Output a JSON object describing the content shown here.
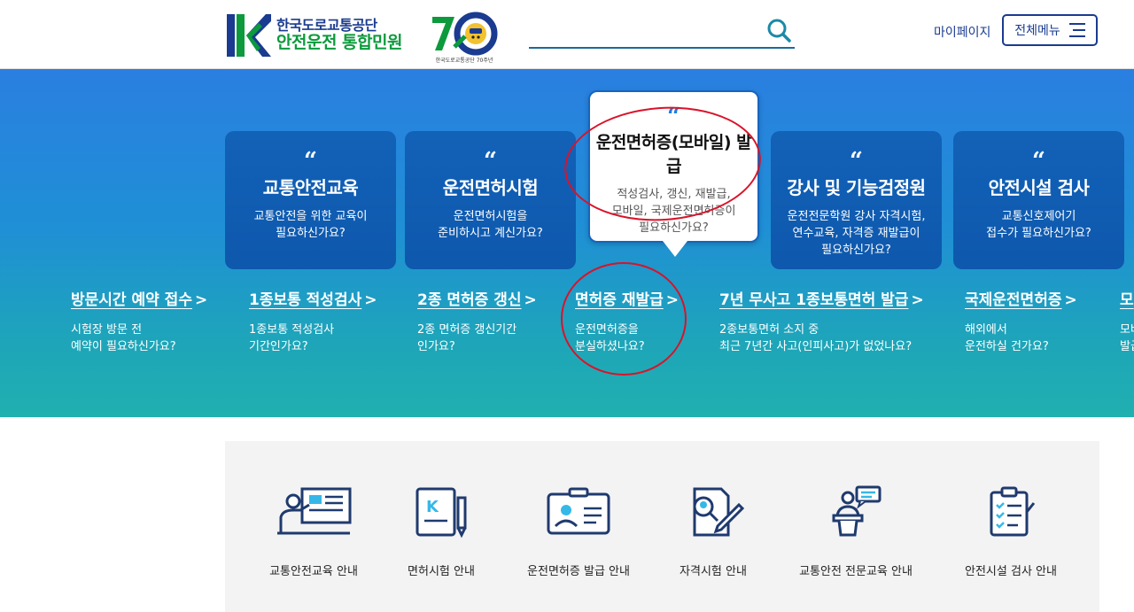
{
  "header": {
    "logo_org": "한국도로교통공단",
    "logo_service": "안전운전 통합민원",
    "anniversary_caption": "한국도로교통공단 70주년",
    "search_placeholder": "",
    "mypage_label": "마이페이지",
    "allmenu_label": "전체메뉴"
  },
  "cards": [
    {
      "title": "교통안전교육",
      "desc1": "교통안전을 위한 교육이",
      "desc2": "필요하신가요?",
      "desc3": ""
    },
    {
      "title": "운전면허시험",
      "desc1": "운전면허시험을",
      "desc2": "준비하시고 계신가요?",
      "desc3": ""
    },
    {
      "title": "운전면허증(모바일) 발급",
      "desc1": "적성검사, 갱신, 재발급,",
      "desc2": "모바일, 국제운전면허증이",
      "desc3": "필요하신가요?"
    },
    {
      "title": "강사 및 기능검정원",
      "desc1": "운전전문학원 강사 자격시험,",
      "desc2": "연수교육, 자격증 재발급이",
      "desc3": "필요하신가요?"
    },
    {
      "title": "안전시설 검사",
      "desc1": "교통신호제어기",
      "desc2": "접수가 필요하신가요?",
      "desc3": ""
    }
  ],
  "links": [
    {
      "title": "방문시간 예약 접수",
      "desc1": "시험장 방문 전",
      "desc2": "예약이 필요하신가요?"
    },
    {
      "title": "1종보통 적성검사",
      "desc1": "1종보통 적성검사",
      "desc2": "기간인가요?"
    },
    {
      "title": "2종 면허증 갱신",
      "desc1": "2종 면허증 갱신기간",
      "desc2": "인가요?"
    },
    {
      "title": "면허증 재발급",
      "desc1": "운전면허증을",
      "desc2": "분실하셨나요?"
    },
    {
      "title": "7년 무사고 1종보통면허 발급",
      "desc1": "2종보통면허 소지 중",
      "desc2": "최근 7년간 사고(인피사고)가 없었나요?"
    },
    {
      "title": "국제운전면허증",
      "desc1": "해외에서",
      "desc2": "운전하실 건가요?"
    },
    {
      "title": "모",
      "desc1": "모바",
      "desc2": "발급"
    }
  ],
  "services": [
    {
      "label": "교통안전교육 안내",
      "icon": "lecture-icon"
    },
    {
      "label": "면허시험 안내",
      "icon": "exam-notebook-icon"
    },
    {
      "label": "운전면허증 발급 안내",
      "icon": "id-card-icon"
    },
    {
      "label": "자격시험 안내",
      "icon": "certificate-pen-icon"
    },
    {
      "label": "교통안전 전문교육 안내",
      "icon": "speaker-podium-icon"
    },
    {
      "label": "안전시설 검사 안내",
      "icon": "clipboard-checklist-icon"
    }
  ],
  "colors": {
    "navy": "#1a3b8f",
    "green": "#0c9a3c",
    "annotation_red": "#d9132a",
    "card_blue": "#1262b8"
  }
}
